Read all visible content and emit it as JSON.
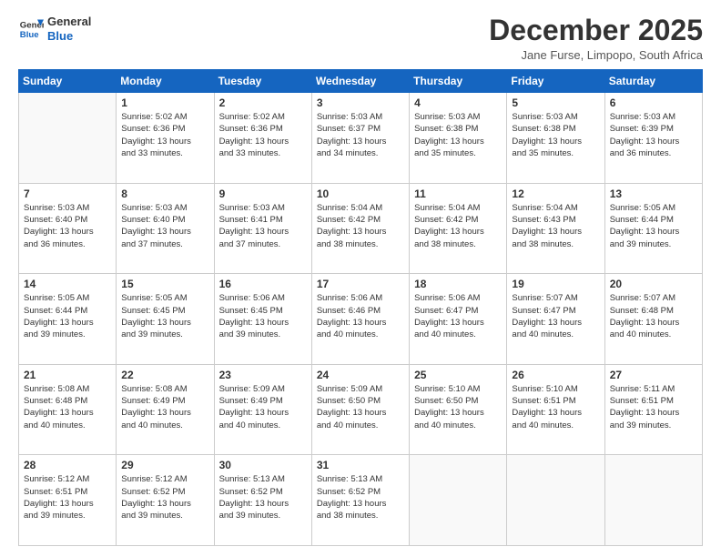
{
  "logo": {
    "line1": "General",
    "line2": "Blue"
  },
  "title": "December 2025",
  "subtitle": "Jane Furse, Limpopo, South Africa",
  "weekdays": [
    "Sunday",
    "Monday",
    "Tuesday",
    "Wednesday",
    "Thursday",
    "Friday",
    "Saturday"
  ],
  "weeks": [
    [
      {
        "day": "",
        "info": ""
      },
      {
        "day": "1",
        "info": "Sunrise: 5:02 AM\nSunset: 6:36 PM\nDaylight: 13 hours\nand 33 minutes."
      },
      {
        "day": "2",
        "info": "Sunrise: 5:02 AM\nSunset: 6:36 PM\nDaylight: 13 hours\nand 33 minutes."
      },
      {
        "day": "3",
        "info": "Sunrise: 5:03 AM\nSunset: 6:37 PM\nDaylight: 13 hours\nand 34 minutes."
      },
      {
        "day": "4",
        "info": "Sunrise: 5:03 AM\nSunset: 6:38 PM\nDaylight: 13 hours\nand 35 minutes."
      },
      {
        "day": "5",
        "info": "Sunrise: 5:03 AM\nSunset: 6:38 PM\nDaylight: 13 hours\nand 35 minutes."
      },
      {
        "day": "6",
        "info": "Sunrise: 5:03 AM\nSunset: 6:39 PM\nDaylight: 13 hours\nand 36 minutes."
      }
    ],
    [
      {
        "day": "7",
        "info": "Sunrise: 5:03 AM\nSunset: 6:40 PM\nDaylight: 13 hours\nand 36 minutes."
      },
      {
        "day": "8",
        "info": "Sunrise: 5:03 AM\nSunset: 6:40 PM\nDaylight: 13 hours\nand 37 minutes."
      },
      {
        "day": "9",
        "info": "Sunrise: 5:03 AM\nSunset: 6:41 PM\nDaylight: 13 hours\nand 37 minutes."
      },
      {
        "day": "10",
        "info": "Sunrise: 5:04 AM\nSunset: 6:42 PM\nDaylight: 13 hours\nand 38 minutes."
      },
      {
        "day": "11",
        "info": "Sunrise: 5:04 AM\nSunset: 6:42 PM\nDaylight: 13 hours\nand 38 minutes."
      },
      {
        "day": "12",
        "info": "Sunrise: 5:04 AM\nSunset: 6:43 PM\nDaylight: 13 hours\nand 38 minutes."
      },
      {
        "day": "13",
        "info": "Sunrise: 5:05 AM\nSunset: 6:44 PM\nDaylight: 13 hours\nand 39 minutes."
      }
    ],
    [
      {
        "day": "14",
        "info": "Sunrise: 5:05 AM\nSunset: 6:44 PM\nDaylight: 13 hours\nand 39 minutes."
      },
      {
        "day": "15",
        "info": "Sunrise: 5:05 AM\nSunset: 6:45 PM\nDaylight: 13 hours\nand 39 minutes."
      },
      {
        "day": "16",
        "info": "Sunrise: 5:06 AM\nSunset: 6:45 PM\nDaylight: 13 hours\nand 39 minutes."
      },
      {
        "day": "17",
        "info": "Sunrise: 5:06 AM\nSunset: 6:46 PM\nDaylight: 13 hours\nand 40 minutes."
      },
      {
        "day": "18",
        "info": "Sunrise: 5:06 AM\nSunset: 6:47 PM\nDaylight: 13 hours\nand 40 minutes."
      },
      {
        "day": "19",
        "info": "Sunrise: 5:07 AM\nSunset: 6:47 PM\nDaylight: 13 hours\nand 40 minutes."
      },
      {
        "day": "20",
        "info": "Sunrise: 5:07 AM\nSunset: 6:48 PM\nDaylight: 13 hours\nand 40 minutes."
      }
    ],
    [
      {
        "day": "21",
        "info": "Sunrise: 5:08 AM\nSunset: 6:48 PM\nDaylight: 13 hours\nand 40 minutes."
      },
      {
        "day": "22",
        "info": "Sunrise: 5:08 AM\nSunset: 6:49 PM\nDaylight: 13 hours\nand 40 minutes."
      },
      {
        "day": "23",
        "info": "Sunrise: 5:09 AM\nSunset: 6:49 PM\nDaylight: 13 hours\nand 40 minutes."
      },
      {
        "day": "24",
        "info": "Sunrise: 5:09 AM\nSunset: 6:50 PM\nDaylight: 13 hours\nand 40 minutes."
      },
      {
        "day": "25",
        "info": "Sunrise: 5:10 AM\nSunset: 6:50 PM\nDaylight: 13 hours\nand 40 minutes."
      },
      {
        "day": "26",
        "info": "Sunrise: 5:10 AM\nSunset: 6:51 PM\nDaylight: 13 hours\nand 40 minutes."
      },
      {
        "day": "27",
        "info": "Sunrise: 5:11 AM\nSunset: 6:51 PM\nDaylight: 13 hours\nand 39 minutes."
      }
    ],
    [
      {
        "day": "28",
        "info": "Sunrise: 5:12 AM\nSunset: 6:51 PM\nDaylight: 13 hours\nand 39 minutes."
      },
      {
        "day": "29",
        "info": "Sunrise: 5:12 AM\nSunset: 6:52 PM\nDaylight: 13 hours\nand 39 minutes."
      },
      {
        "day": "30",
        "info": "Sunrise: 5:13 AM\nSunset: 6:52 PM\nDaylight: 13 hours\nand 39 minutes."
      },
      {
        "day": "31",
        "info": "Sunrise: 5:13 AM\nSunset: 6:52 PM\nDaylight: 13 hours\nand 38 minutes."
      },
      {
        "day": "",
        "info": ""
      },
      {
        "day": "",
        "info": ""
      },
      {
        "day": "",
        "info": ""
      }
    ]
  ]
}
